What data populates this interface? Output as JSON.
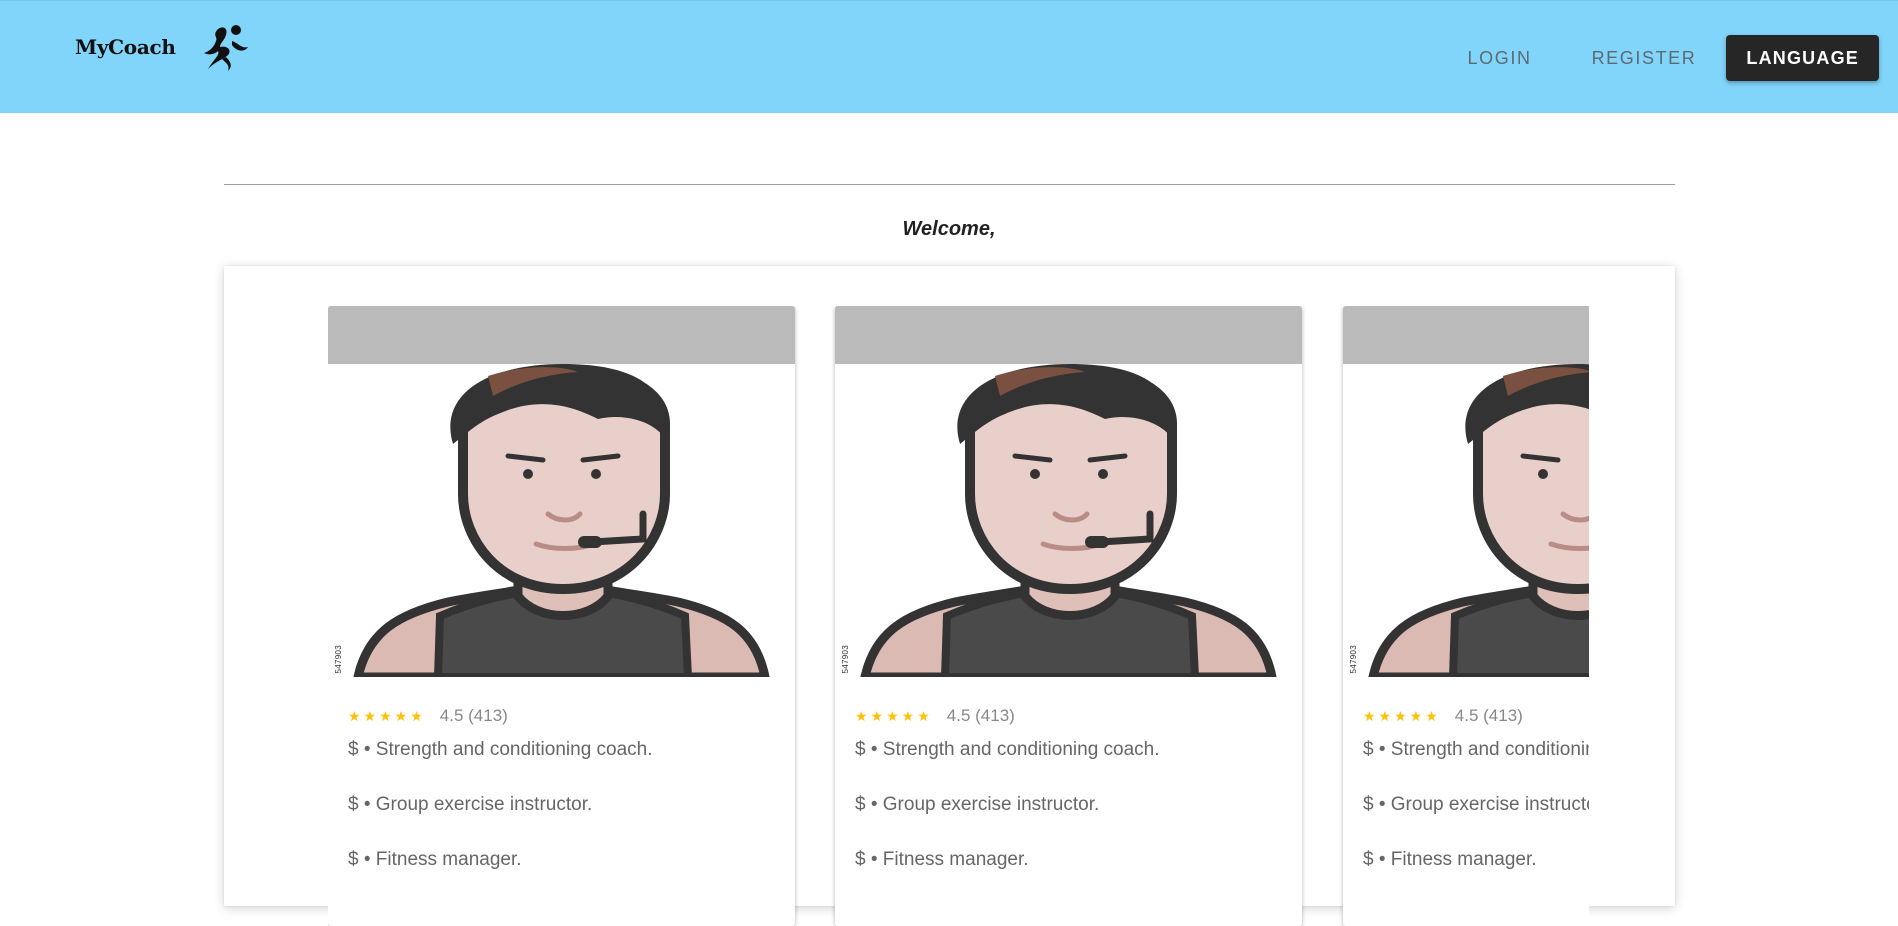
{
  "app": {
    "logo_text": "MyCoach",
    "logo_icon": "running-person-icon"
  },
  "nav": {
    "login": "LOGIN",
    "register": "REGISTER",
    "language": "LANGUAGE"
  },
  "welcome": "Welcome,",
  "coaches": [
    {
      "stock_id": "547903",
      "rating_stars": "★★★★★",
      "rating_text": "4.5 (413)",
      "specialties": [
        "$ • Strength and conditioning coach.",
        "$ • Group exercise instructor.",
        "$ • Fitness manager."
      ]
    },
    {
      "stock_id": "547903",
      "rating_stars": "★★★★★",
      "rating_text": "4.5 (413)",
      "specialties": [
        "$ • Strength and conditioning coach.",
        "$ • Group exercise instructor.",
        "$ • Fitness manager."
      ]
    },
    {
      "stock_id": "547903",
      "rating_stars": "★★★★★",
      "rating_text": "4.5 (413)",
      "specialties": [
        "$ • Strength and conditioning coach.",
        "$ • Group exercise instructor.",
        "$ • Fitness manager."
      ]
    }
  ],
  "colors": {
    "header_bg": "#81d4fa",
    "language_button_bg": "#262626",
    "star": "#ffc107",
    "card_header": "#bababa"
  }
}
